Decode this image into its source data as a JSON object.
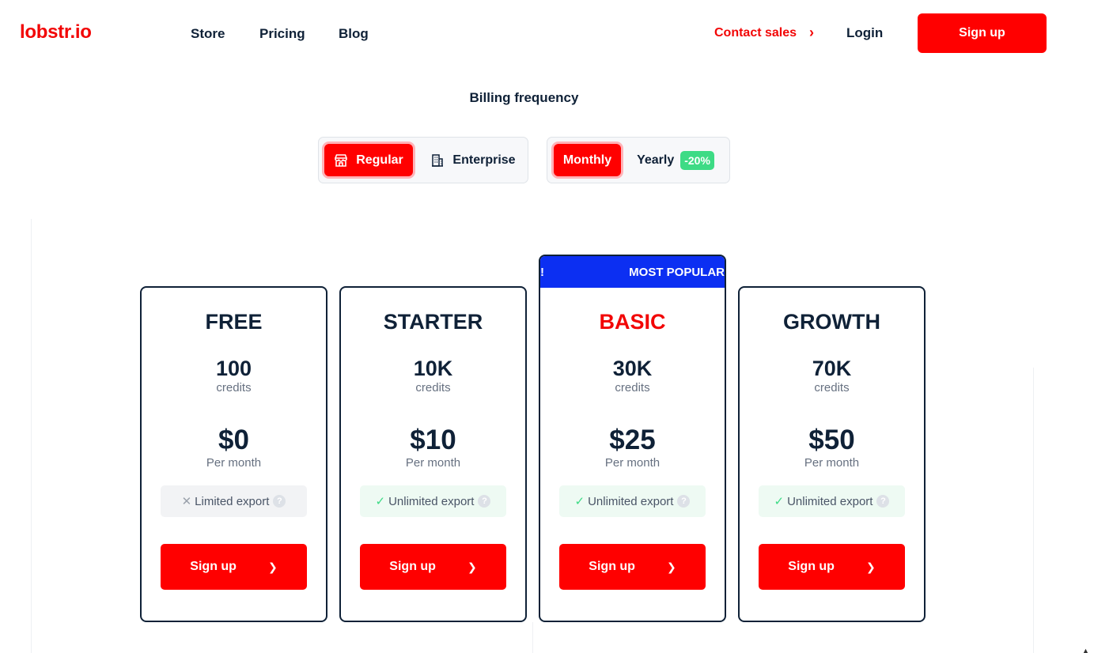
{
  "brand": {
    "logo": "lobstr.io",
    "accent": "#ff0000",
    "popular_blue": "#0c2ff2",
    "success_green": "#3ddb85"
  },
  "nav": {
    "store": "Store",
    "pricing": "Pricing",
    "blog": "Blog"
  },
  "header": {
    "contact_sales": "Contact sales",
    "contact_chevron": "›",
    "login": "Login",
    "signup": "Sign up"
  },
  "billing": {
    "title": "Billing frequency",
    "plan_types": {
      "regular": "Regular",
      "enterprise": "Enterprise",
      "selected": "Regular"
    },
    "periods": {
      "monthly": "Monthly",
      "yearly": "Yearly",
      "yearly_badge": "-20%",
      "selected": "Monthly"
    }
  },
  "plans": [
    {
      "name": "FREE",
      "credits": "100",
      "credits_label": "credits",
      "price": "$0",
      "period": "Per month",
      "export": "Limited export",
      "export_icon": "x-icon",
      "help": "?",
      "cta": "Sign up"
    },
    {
      "name": "STARTER",
      "credits": "10K",
      "credits_label": "credits",
      "price": "$10",
      "period": "Per month",
      "export": "Unlimited export",
      "export_icon": "check-icon",
      "help": "?",
      "cta": "Sign up"
    },
    {
      "name": "BASIC",
      "credits": "30K",
      "credits_label": "credits",
      "price": "$25",
      "period": "Per month",
      "export": "Unlimited export",
      "export_icon": "check-icon",
      "help": "?",
      "cta": "Sign up",
      "banner_left": "!",
      "banner": "MOST POPULAR"
    },
    {
      "name": "GROWTH",
      "credits": "70K",
      "credits_label": "credits",
      "price": "$50",
      "period": "Per month",
      "export": "Unlimited export",
      "export_icon": "check-icon",
      "help": "?",
      "cta": "Sign up"
    }
  ]
}
